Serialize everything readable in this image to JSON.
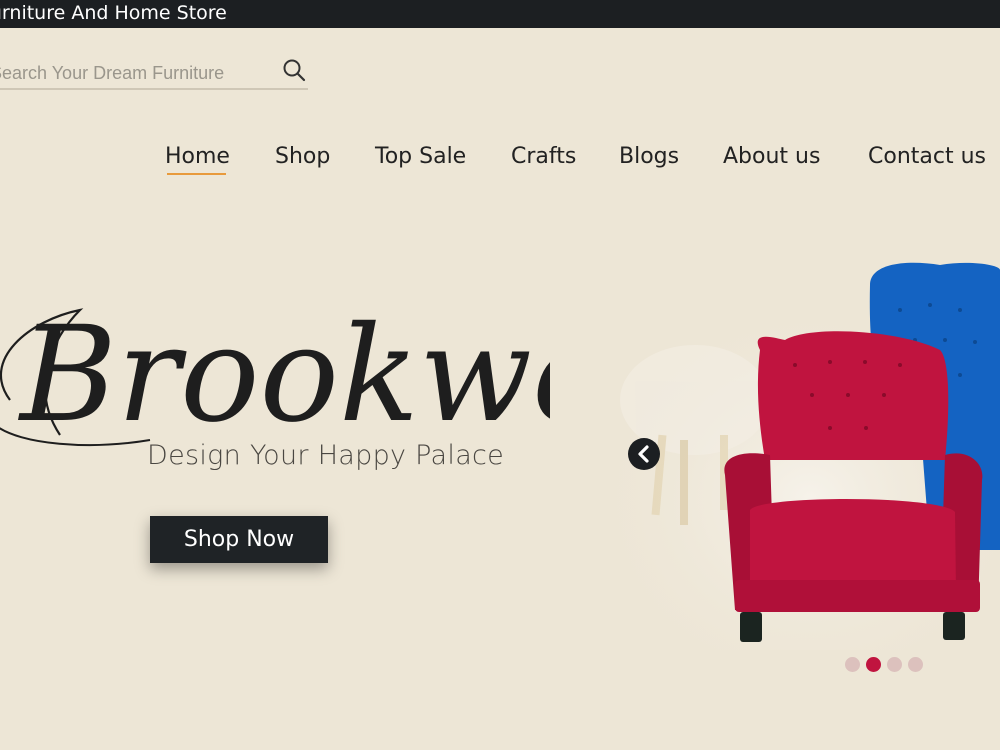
{
  "topbar": {
    "store_name": "Furniture And Home Store"
  },
  "search": {
    "placeholder": "Search Your Dream Furniture",
    "icon": "search-icon"
  },
  "nav": {
    "items": [
      {
        "label": "Home",
        "active": true
      },
      {
        "label": "Shop"
      },
      {
        "label": "Top Sale"
      },
      {
        "label": "Crafts"
      },
      {
        "label": "Blogs"
      },
      {
        "label": "About us"
      },
      {
        "label": "Contact us"
      }
    ]
  },
  "hero": {
    "brand": "Brookwood",
    "tagline": "Design Your Happy Palace",
    "cta_label": "Shop Now"
  },
  "carousel": {
    "prev_icon": "chevron-left-icon",
    "slide_count": 4,
    "active_slide": 2
  },
  "colors": {
    "background": "#ede6d6",
    "topbar": "#1c1f22",
    "accent_underline": "#e89a3c",
    "chair_red": "#c0143f",
    "chair_blue": "#1463c2",
    "dot_inactive": "#dcc1bd"
  }
}
